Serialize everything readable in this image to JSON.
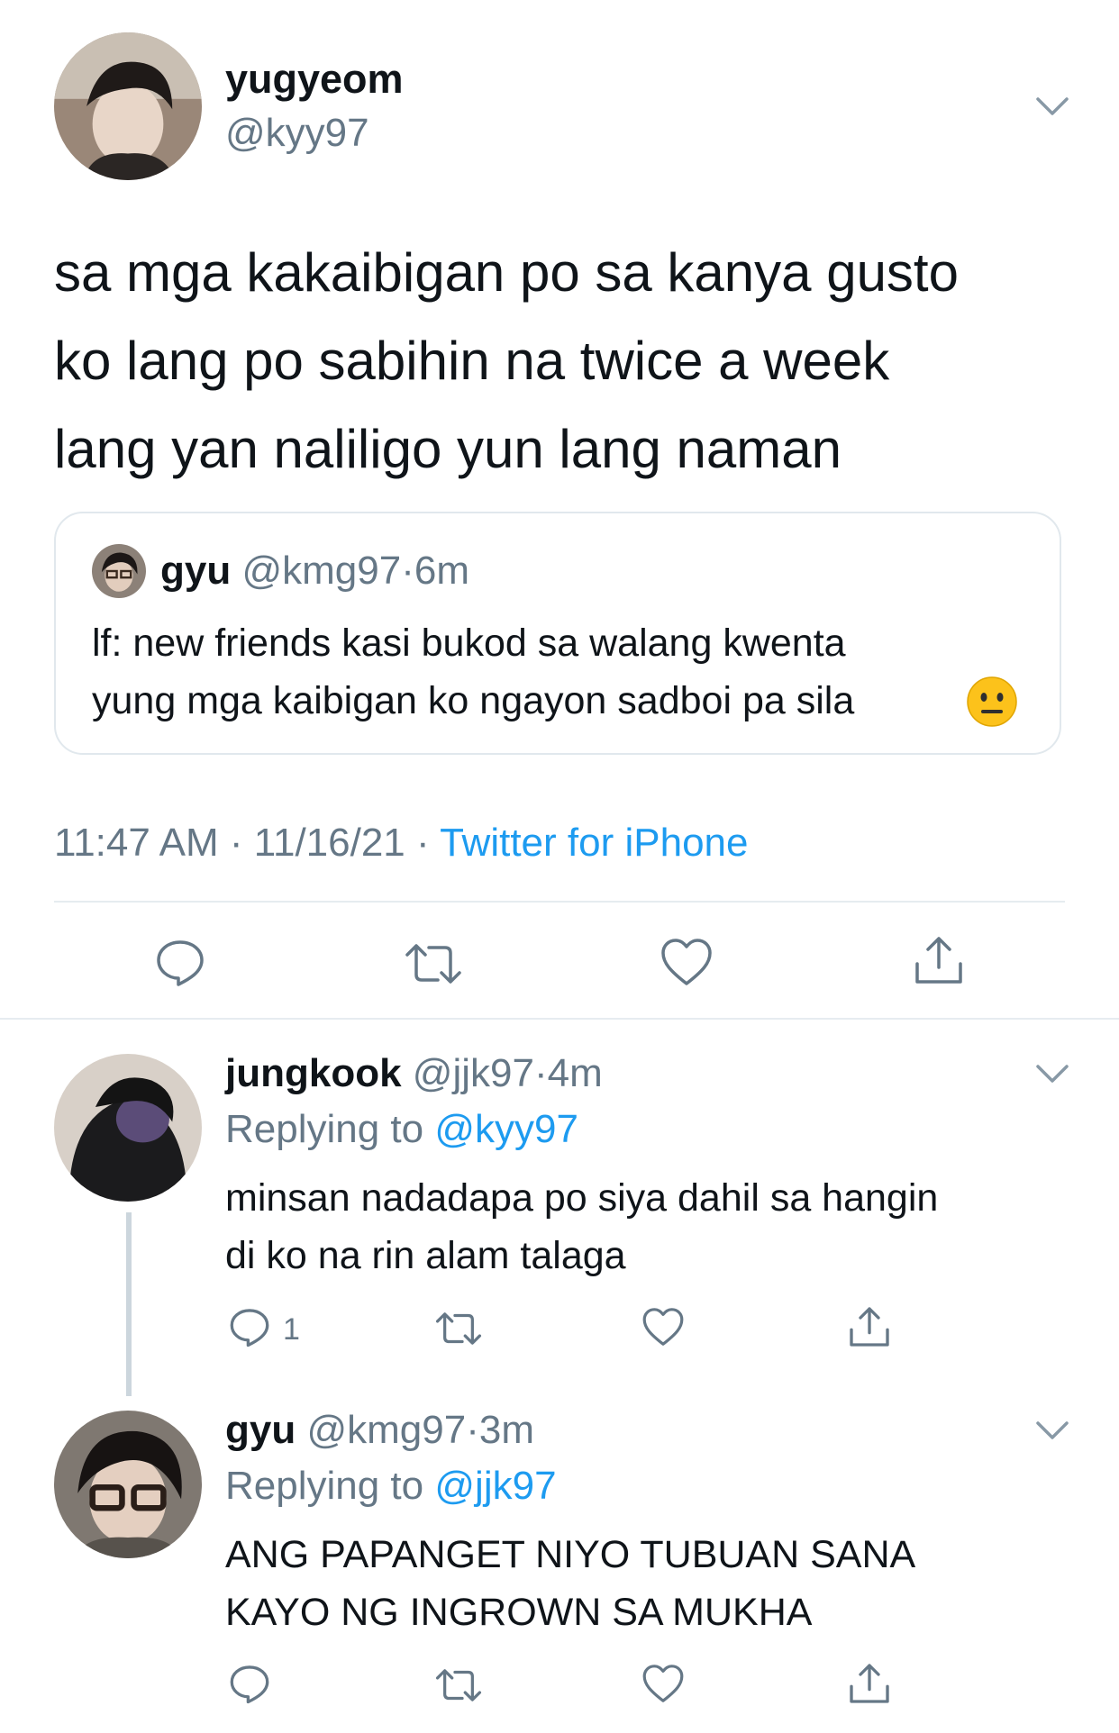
{
  "main_tweet": {
    "display_name": "yugyeom",
    "handle": "@kyy97",
    "text_lines": [
      "sa mga kakaibigan po sa kanya gusto",
      "ko lang po sabihin na twice a week",
      "lang yan naliligo yun lang naman"
    ],
    "quoted": {
      "display_name": "gyu",
      "handle": "@kmg97",
      "dot": "·",
      "time": "6m",
      "text_lines": [
        "lf: new friends kasi bukod sa walang kwenta",
        "yung mga kaibigan ko ngayon sadboi pa sila"
      ],
      "emoji": "neutral-face-emoji"
    },
    "meta": {
      "time": "11:47 AM",
      "sep1": "·",
      "date": "11/16/21",
      "sep2": "·",
      "source": "Twitter for iPhone"
    },
    "actions": [
      "reply-icon",
      "retweet-icon",
      "like-icon",
      "share-icon"
    ]
  },
  "replies": [
    {
      "display_name": "jungkook",
      "handle": "@jjk97",
      "dot": "·",
      "time": "4m",
      "replying_prefix": "Replying to",
      "replying_to": "@kyy97",
      "text_lines": [
        "minsan nadadapa po siya dahil sa hangin",
        "di ko na rin alam talaga"
      ],
      "reply_count": "1"
    },
    {
      "display_name": "gyu",
      "handle": "@kmg97",
      "dot": "·",
      "time": "3m",
      "replying_prefix": "Replying to",
      "replying_to": "@jjk97",
      "text_lines": [
        "ANG PAPANGET NIYO TUBUAN SANA",
        "KAYO NG INGROWN SA MUKHA"
      ],
      "reply_count": ""
    }
  ],
  "colors": {
    "text": "#0f1419",
    "muted": "#657786",
    "link": "#1d9bf0",
    "divider": "#e6ecf0",
    "icon": "#657786"
  }
}
